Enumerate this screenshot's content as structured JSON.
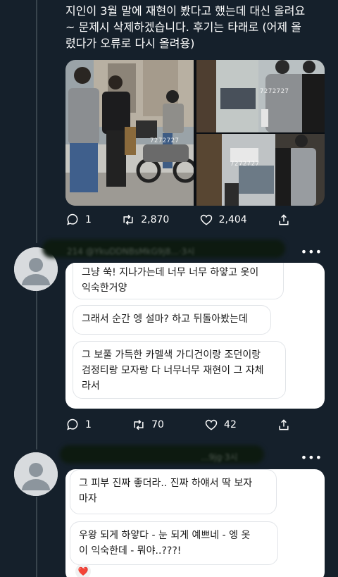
{
  "tweet": {
    "text": "지인이 3월 말에 재현이 봤다고 했는데 대신 올려요\n~ 문제시 삭제하겠습니다. 후기는 타래로 (어제 올\n렸다가 오류로 다시 올려용)",
    "watermark": "7272727",
    "actions": {
      "replies": "1",
      "retweets": "2,870",
      "likes": "2,404"
    }
  },
  "reply1": {
    "handle": "214 @YkuDDNBsMkG9j8...·3시",
    "messages": [
      "그냥 쑥! 지나가는데 너무 너무 하얗고 옷이\n익숙한거양",
      "그래서 순간 엥 설마? 하고 뒤돌아봤는데",
      "그 보풀 가득한 카멜색 가디건이랑 조던이랑\n검정티랑 모자랑 다 너무너무 재현이 그 자체\n라서"
    ],
    "actions": {
      "replies": "1",
      "retweets": "70",
      "likes": "42"
    }
  },
  "reply2": {
    "handle": "...9jg·3시",
    "messages": [
      "그 피부 진짜 좋더라.. 진짜 하얘서 딱 보자\n마자",
      "우왕 되게 하얗다 - 눈 되게 예쁘네 - 엥 옷\n이 익숙한데 - 뭐야..???!"
    ],
    "reaction": "❤️"
  },
  "colors": {
    "background": "#15202b",
    "text": "#ffffff",
    "bubble_border": "#e1e4e8"
  }
}
